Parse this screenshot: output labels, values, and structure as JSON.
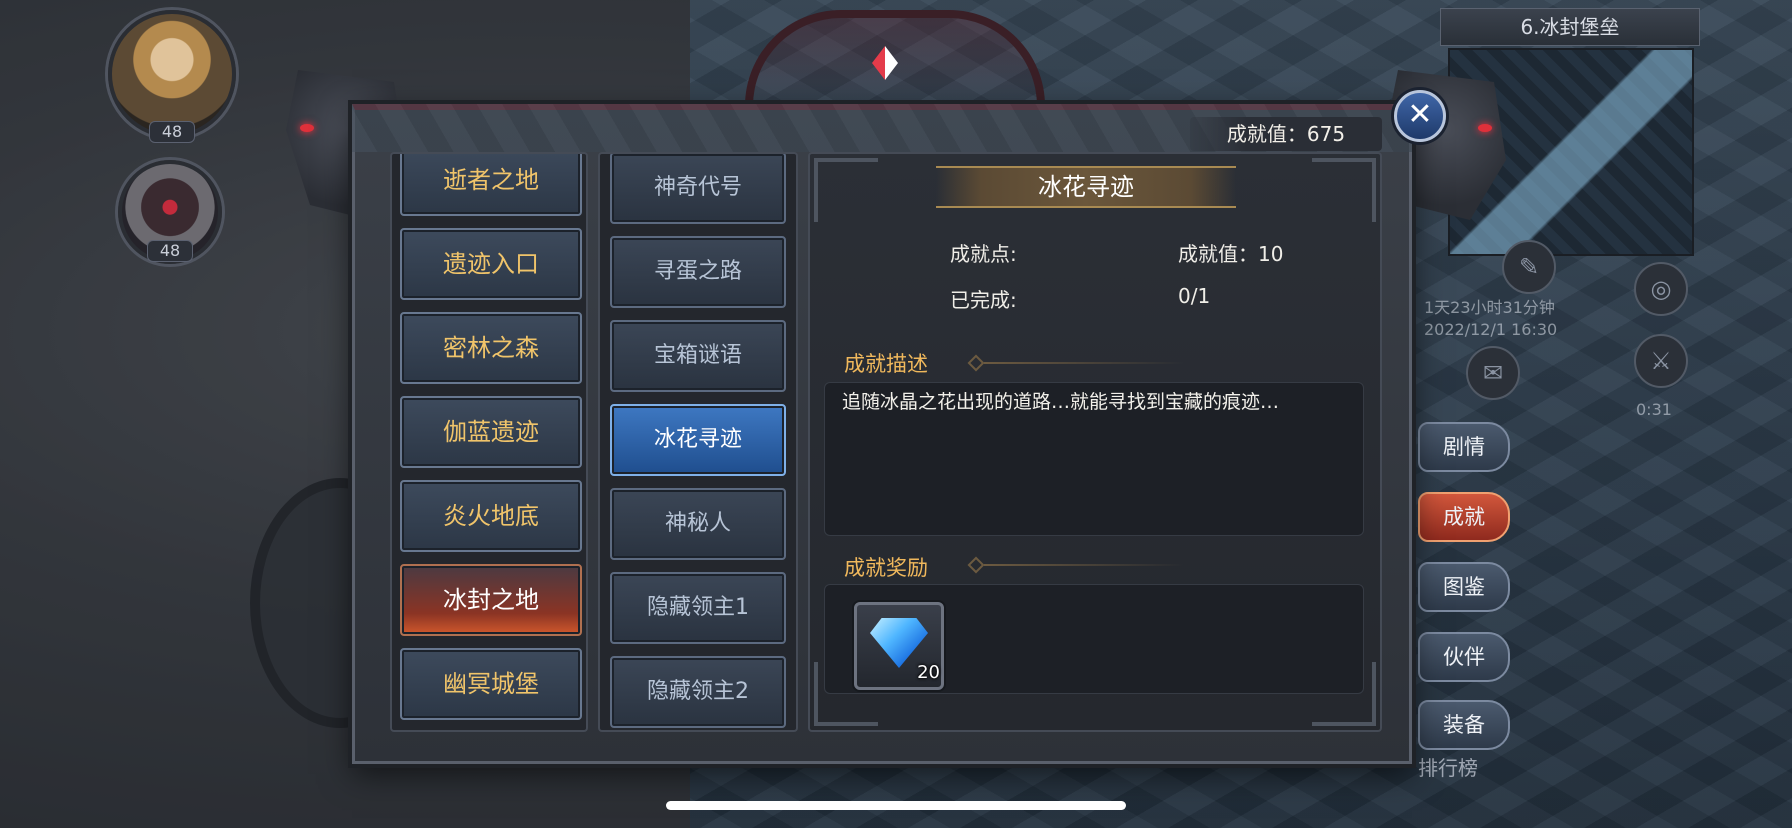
{
  "players": [
    {
      "level": "48"
    },
    {
      "level": "48"
    }
  ],
  "map": {
    "title": "6.冰封堡垒"
  },
  "hud": {
    "countdown": "1天23小时31分钟",
    "datetime": "2022/12/1 16:30",
    "timer": "0:31",
    "side_tabs": [
      "剧情",
      "成就",
      "图鉴",
      "伙伴",
      "装备"
    ],
    "rank_label": "排行榜"
  },
  "dialog": {
    "total_score": "成就值：675",
    "close_symbol": "✕",
    "areas": [
      "逝者之地",
      "遗迹入口",
      "密林之森",
      "伽蓝遗迹",
      "炎火地底",
      "冰封之地",
      "幽冥城堡"
    ],
    "active_area": "冰封之地",
    "achievements": [
      "神奇代号",
      "寻蛋之路",
      "宝箱谜语",
      "冰花寻迹",
      "神秘人",
      "隐藏领主1",
      "隐藏领主2"
    ],
    "active_achievement": "冰花寻迹",
    "detail": {
      "title": "冰花寻迹",
      "points_label": "成就点:",
      "points_value": "成就值：10",
      "completed_label": "已完成:",
      "completed_value": "0/1",
      "desc_heading": "成就描述",
      "description": "追随冰晶之花出现的道路…就能寻找到宝藏的痕迹…",
      "reward_heading": "成就奖励",
      "reward_item": "diamond-gem-icon",
      "reward_count": "20"
    }
  },
  "colors": {
    "accent_gold": "#f0b85c",
    "active_blue": "#3e78c2",
    "active_red": "#8b3424"
  }
}
